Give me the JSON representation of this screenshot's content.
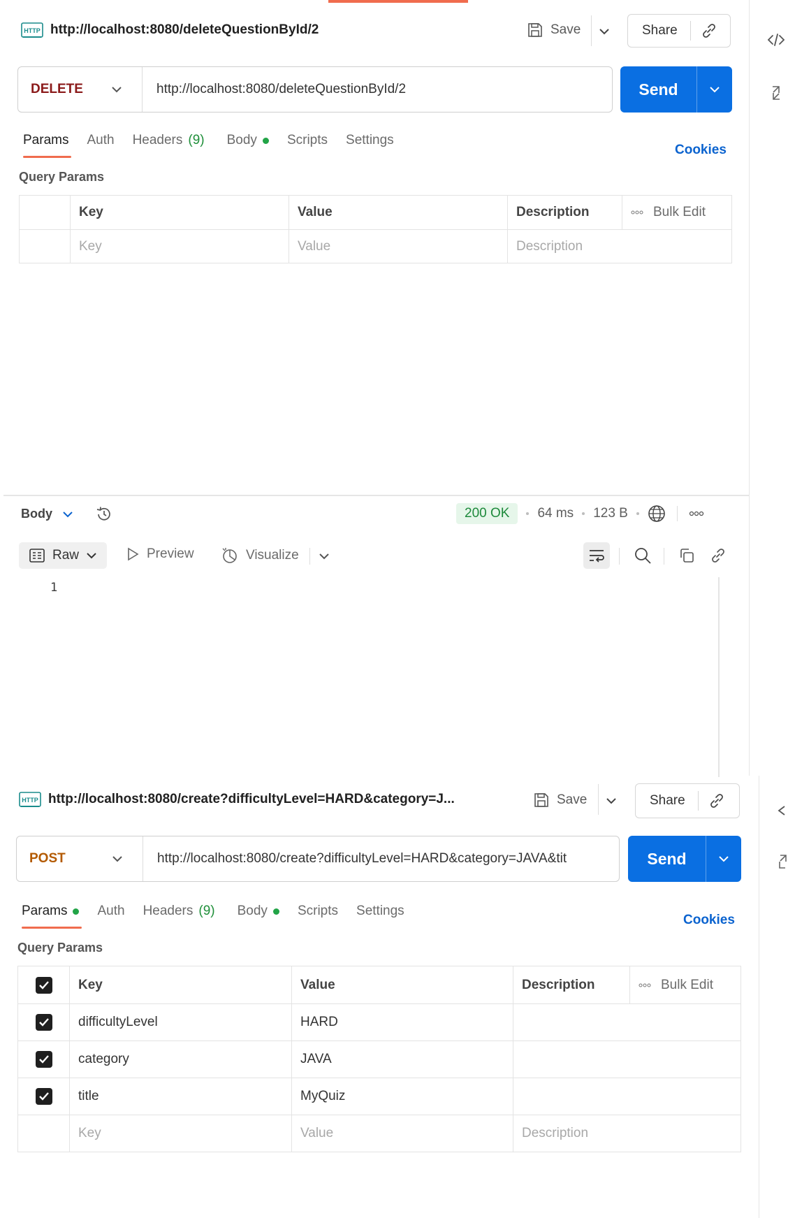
{
  "request1": {
    "title": "http://localhost:8080/deleteQuestionById/2",
    "save_label": "Save",
    "share_label": "Share",
    "method": "DELETE",
    "method_color": "#8b1a1a",
    "url": "http://localhost:8080/deleteQuestionById/2",
    "send_label": "Send",
    "tabs": [
      {
        "label": "Params"
      },
      {
        "label": "Auth"
      },
      {
        "label": "Headers",
        "count": "(9)"
      },
      {
        "label": "Body"
      },
      {
        "label": "Scripts"
      },
      {
        "label": "Settings"
      }
    ],
    "cookies_label": "Cookies",
    "query_params_label": "Query Params",
    "table": {
      "headers": [
        "Key",
        "Value",
        "Description"
      ],
      "bulk_edit": "Bulk Edit",
      "placeholder": {
        "key": "Key",
        "value": "Value",
        "description": "Description"
      }
    }
  },
  "response": {
    "body_label": "Body",
    "status": "200 OK",
    "time": "64 ms",
    "size": "123 B",
    "raw_label": "Raw",
    "preview_label": "Preview",
    "visualize_label": "Visualize",
    "line_numbers": [
      "1"
    ]
  },
  "request2": {
    "title": "http://localhost:8080/create?difficultyLevel=HARD&category=J...",
    "save_label": "Save",
    "share_label": "Share",
    "method": "POST",
    "method_color": "#b35a00",
    "url": "http://localhost:8080/create?difficultyLevel=HARD&category=JAVA&tit",
    "send_label": "Send",
    "tabs": [
      {
        "label": "Params"
      },
      {
        "label": "Auth"
      },
      {
        "label": "Headers",
        "count": "(9)"
      },
      {
        "label": "Body"
      },
      {
        "label": "Scripts"
      },
      {
        "label": "Settings"
      }
    ],
    "cookies_label": "Cookies",
    "query_params_label": "Query Params",
    "table": {
      "headers": [
        "Key",
        "Value",
        "Description"
      ],
      "bulk_edit": "Bulk Edit",
      "rows": [
        {
          "key": "difficultyLevel",
          "value": "HARD",
          "checked": true
        },
        {
          "key": "category",
          "value": "JAVA",
          "checked": true
        },
        {
          "key": "title",
          "value": "MyQuiz",
          "checked": true
        }
      ],
      "placeholder": {
        "key": "Key",
        "value": "Value",
        "description": "Description"
      }
    }
  },
  "colors": {
    "send": "#0a6fe2",
    "accent": "#f06c4e",
    "status_ok": "#1e8a3c",
    "cookies": "#0b63cf"
  }
}
